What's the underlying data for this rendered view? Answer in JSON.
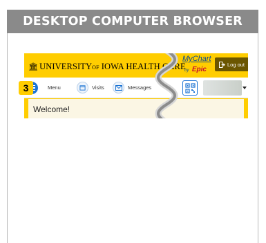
{
  "banner": {
    "title": "DESKTOP COMPUTER BROWSER"
  },
  "header": {
    "brand": {
      "prefix": "UNIVERSITY",
      "of": "OF",
      "suffix": "IOWA HEALTH CARE"
    },
    "mychart": {
      "name": "MyChart",
      "by": "by",
      "epic": "Epic"
    },
    "logout_label": "Log out"
  },
  "nav": {
    "items": [
      {
        "label": "Menu",
        "icon": "hamburger-icon"
      },
      {
        "label": "Visits",
        "icon": "calendar-icon"
      },
      {
        "label": "Messages",
        "icon": "envelope-icon"
      }
    ],
    "qr_icon": "qr-code-icon"
  },
  "content": {
    "welcome": "Welcome!"
  },
  "step_badge": "3",
  "colors": {
    "brand_yellow": "#ffcd00",
    "logout_bg": "#6b5600",
    "accent_blue": "#1b73d3",
    "banner_gray": "#8a8a8a"
  }
}
